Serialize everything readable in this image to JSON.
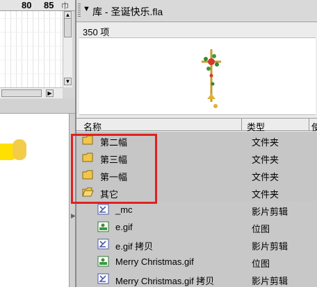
{
  "timeline": {
    "ruler_labels": [
      "80",
      "85"
    ],
    "ruler_suffix": "巾"
  },
  "library": {
    "title": "库 - 圣诞快乐.fla",
    "item_count": "350 项",
    "columns": {
      "name": "名称",
      "type": "类型",
      "extra": "使"
    },
    "folders": [
      {
        "name": "第二幅",
        "type": "文件夹",
        "icon": "folder-icon"
      },
      {
        "name": "第三幅",
        "type": "文件夹",
        "icon": "folder-icon"
      },
      {
        "name": "第一幅",
        "type": "文件夹",
        "icon": "folder-icon"
      },
      {
        "name": "其它",
        "type": "文件夹",
        "icon": "folder-open-icon"
      }
    ],
    "items": [
      {
        "name": "_mc",
        "type": "影片剪辑",
        "icon": "movieclip-icon"
      },
      {
        "name": "e.gif",
        "type": "位图",
        "icon": "bitmap-icon"
      },
      {
        "name": "e.gif 拷贝",
        "type": "影片剪辑",
        "icon": "movieclip-icon"
      },
      {
        "name": "Merry Christmas.gif",
        "type": "位图",
        "icon": "bitmap-icon"
      },
      {
        "name": "Merry Christmas.gif 拷贝",
        "type": "影片剪辑",
        "icon": "movieclip-icon"
      }
    ]
  },
  "colors": {
    "highlight_border": "#e0201f",
    "folder_fill": "#f2c64a",
    "selection_row": "#c6c6c6"
  }
}
